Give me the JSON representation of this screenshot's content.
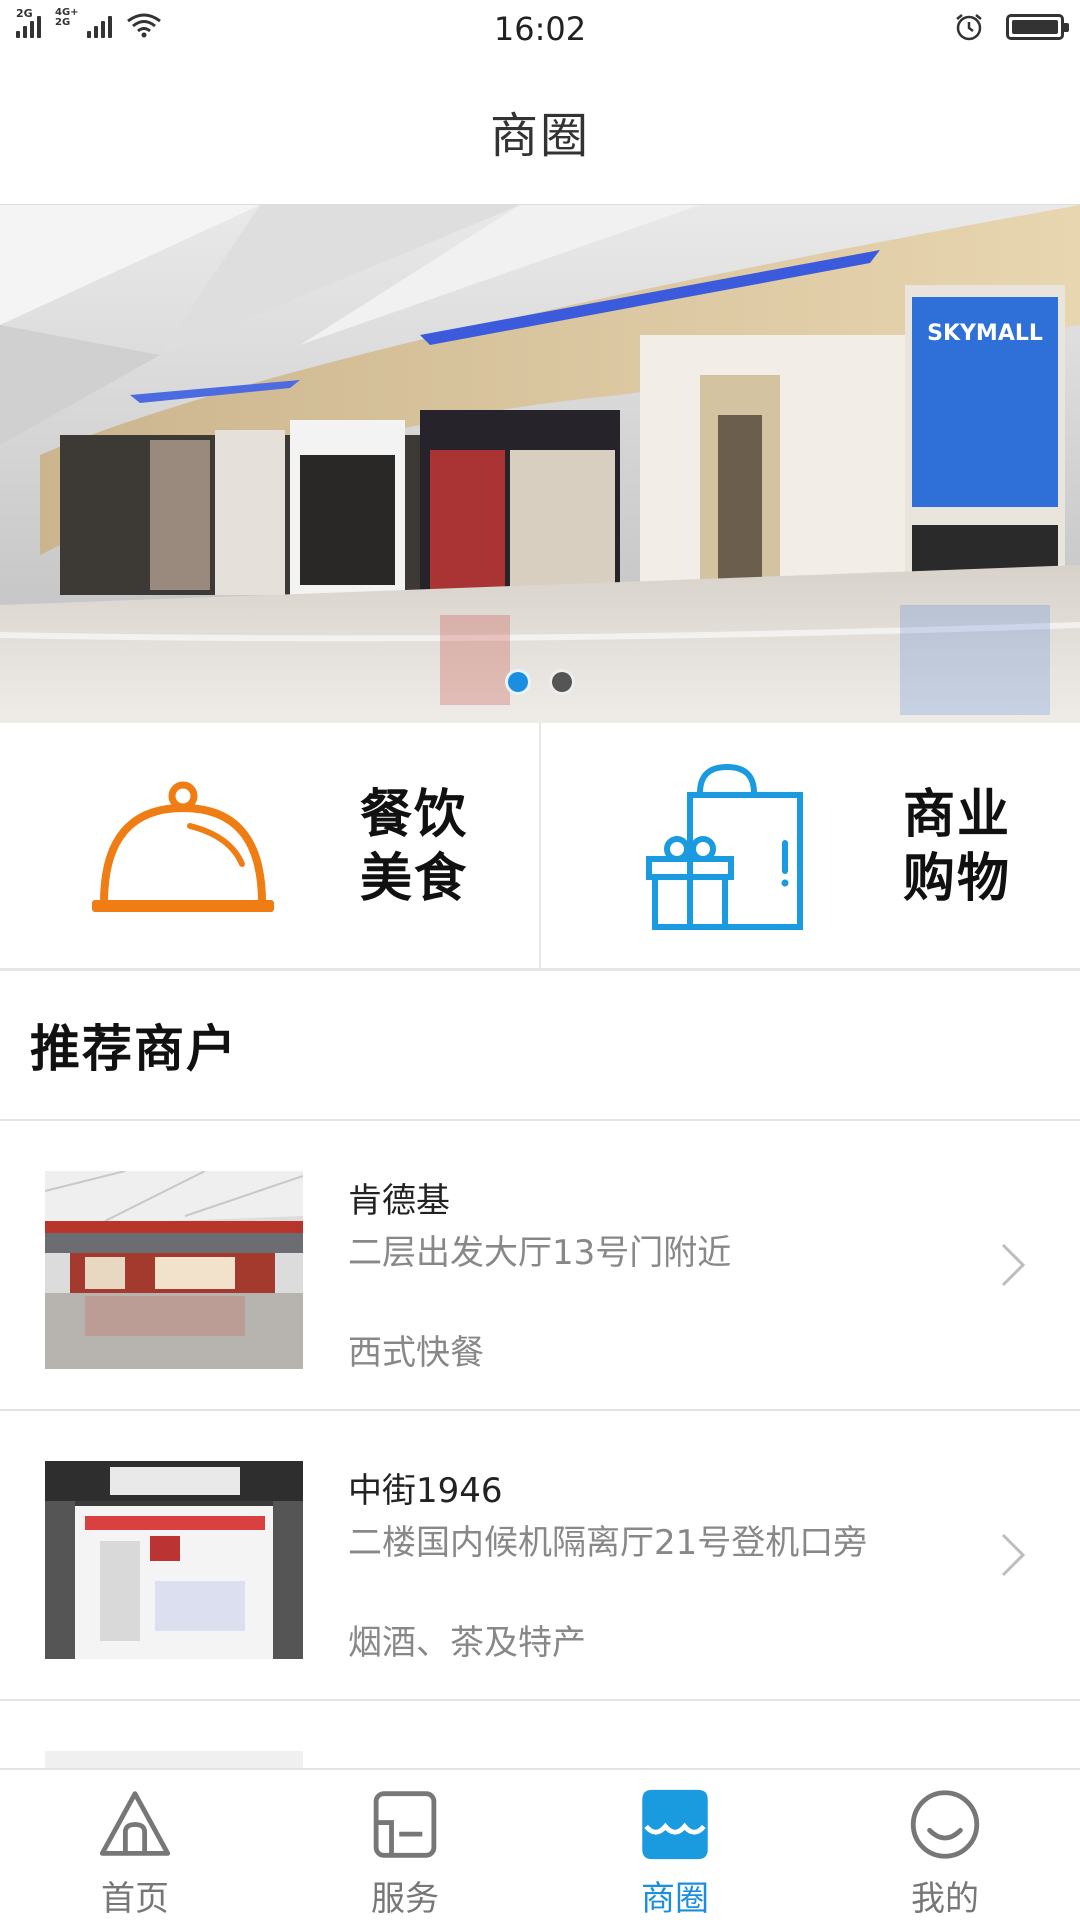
{
  "status_bar": {
    "sim1_label": "2G",
    "sim2_label": "4G+\n2G",
    "time": "16:02"
  },
  "header": {
    "title": "商圈"
  },
  "banner": {
    "slide_count": 2,
    "active_slide": 1,
    "sign_text": "SKYMALL"
  },
  "categories": [
    {
      "line1": "餐饮",
      "line2": "美食",
      "icon": "food-cloche-icon",
      "color": "#f07d13"
    },
    {
      "line1": "商业",
      "line2": "购物",
      "icon": "shopping-bag-gift-icon",
      "color": "#1a9be0"
    }
  ],
  "section": {
    "title": "推荐商户"
  },
  "merchants": [
    {
      "name": "肯德基",
      "address": "二层出发大厅13号门附近",
      "type": "西式快餐"
    },
    {
      "name": "中街1946",
      "address": "二楼国内候机隔离厅21号登机口旁",
      "type": "烟酒、茶及特产"
    }
  ],
  "tabs": [
    {
      "label": "首页",
      "icon": "home-icon"
    },
    {
      "label": "服务",
      "icon": "service-icon"
    },
    {
      "label": "商圈",
      "icon": "shop-awning-icon"
    },
    {
      "label": "我的",
      "icon": "profile-smile-icon"
    }
  ],
  "colors": {
    "accent": "#1a8fe0",
    "food_icon": "#f07d13",
    "shop_icon": "#1a9be0"
  }
}
